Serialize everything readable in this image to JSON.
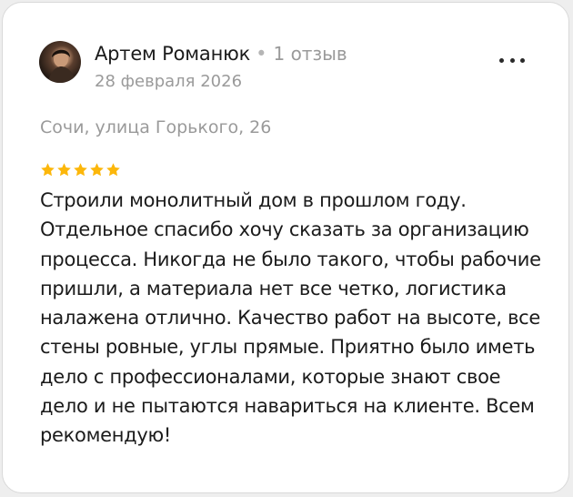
{
  "review": {
    "author_name": "Артем Романюк",
    "separator": "•",
    "review_count": "1 отзыв",
    "date": "28 февраля 2026",
    "address": "Сочи, улица Горького, 26",
    "rating": 5,
    "star_color": "#fcb70b",
    "text": "Строили монолитный дом в прошлом году. Отдельное спасибо хочу сказать за организацию процесса. Никогда не было такого, чтобы рабочие пришли, а материала нет все четко, логистика налажена отлично. Качество работ на высоте, все стены ровные, углы прямые. Приятно было иметь дело с профессионалами, которые знают свое дело и не пытаются навариться на клиенте. Всем рекомендую!"
  },
  "icons": {
    "more": "more-horizontal-icon",
    "star": "star-icon"
  }
}
